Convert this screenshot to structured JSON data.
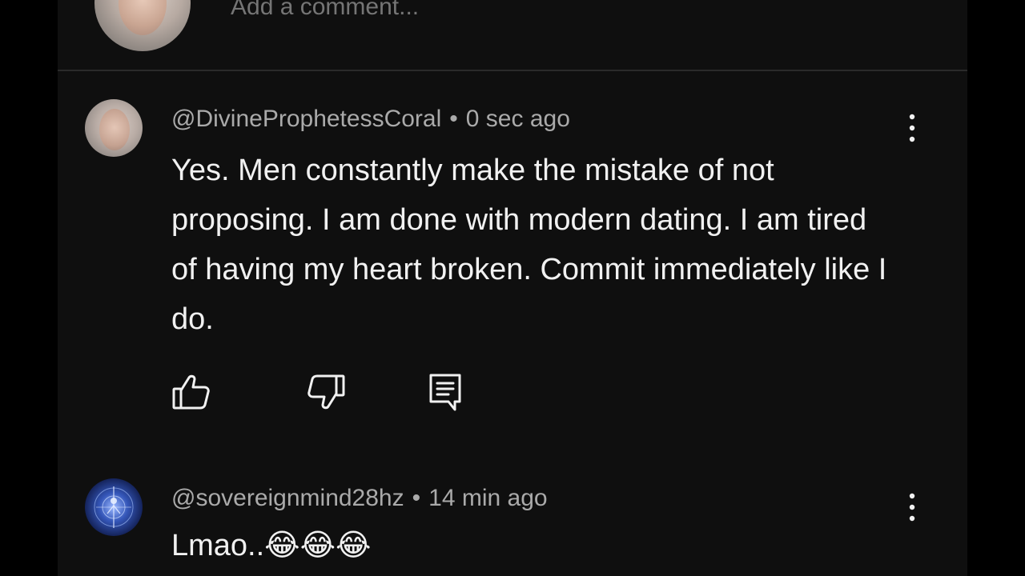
{
  "composer": {
    "placeholder": "Add a comment..."
  },
  "comments": [
    {
      "author": "@DivineProphetessCoral",
      "separator": "•",
      "time": "0 sec ago",
      "text": "Yes. Men constantly make the mistake of not proposing. I am done with modern dating. I am tired of having my heart broken. Commit immediately like I do."
    },
    {
      "author": "@sovereignmind28hz",
      "separator": "•",
      "time": "14 min ago",
      "text": "Lmao..😂😂😂"
    }
  ],
  "icons": {
    "like": "thumbs-up-icon",
    "dislike": "thumbs-down-icon",
    "reply": "reply-comment-icon",
    "more": "more-vertical-icon"
  },
  "colors": {
    "background": "#0f0f0f",
    "text_primary": "#f1f1f1",
    "text_secondary": "#aaaaaa",
    "placeholder": "#6a6a6a",
    "divider": "#2a2a2a"
  }
}
